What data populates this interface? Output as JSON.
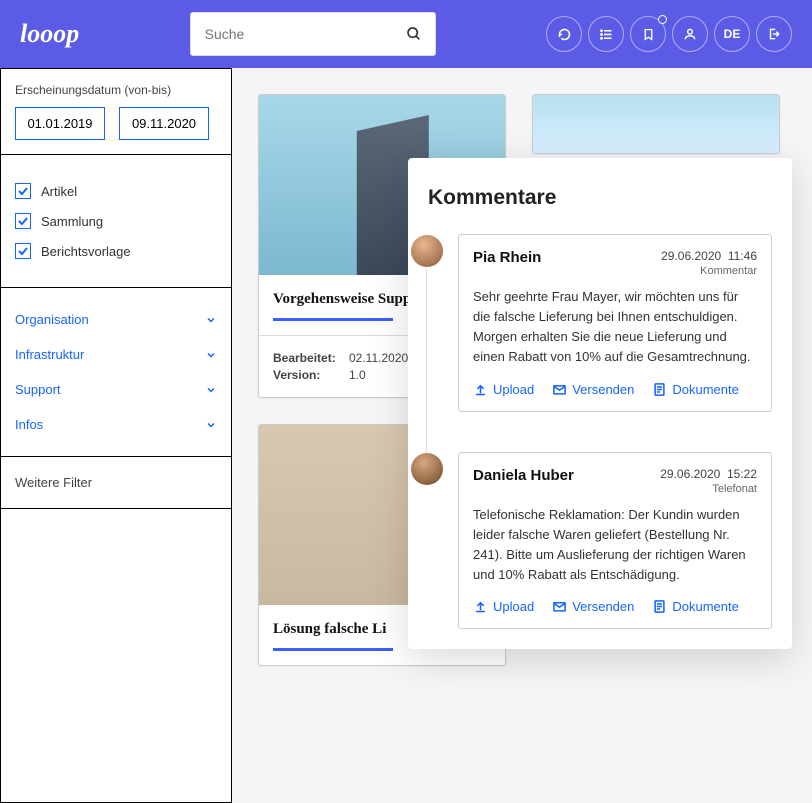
{
  "header": {
    "logo": "looop",
    "search_placeholder": "Suche",
    "lang": "DE"
  },
  "sidebar": {
    "date_label": "Erscheinungsdatum (von-bis)",
    "date_from": "01.01.2019",
    "date_to": "09.11.2020",
    "checks": [
      {
        "label": "Artikel"
      },
      {
        "label": "Sammlung"
      },
      {
        "label": "Berichtsvorlage"
      }
    ],
    "filters": [
      {
        "label": "Organisation"
      },
      {
        "label": "Infrastruktur"
      },
      {
        "label": "Support"
      },
      {
        "label": "Infos"
      }
    ],
    "more_filters": "Weitere Filter"
  },
  "cards": [
    {
      "title": "Vorgehensweise Support Anfrage",
      "edit_label": "Bearbeitet:",
      "edit_value": "02.11.2020",
      "version_label": "Version:",
      "version_value": "1.0"
    },
    {
      "title": "Lösung falsche Li"
    }
  ],
  "comments": {
    "title": "Kommentare",
    "items": [
      {
        "name": "Pia Rhein",
        "date": "29.06.2020",
        "time": "11:46",
        "type": "Kommentar",
        "body": "Sehr geehrte Frau Mayer, wir möchten uns für die falsche Lieferung bei Ihnen entschuldigen. Morgen erhalten Sie die neue Lieferung und einen Rabatt von 10% auf die Gesamtrechnung."
      },
      {
        "name": "Daniela Huber",
        "date": "29.06.2020",
        "time": "15:22",
        "type": "Telefonat",
        "body": "Telefonische Reklamation: Der Kundin wurden leider falsche Waren geliefert (Bestellung Nr. 241). Bitte um Auslieferung der richtigen Waren und 10% Rabatt als Entschädigung."
      }
    ],
    "actions": {
      "upload": "Upload",
      "send": "Versenden",
      "docs": "Dokumente"
    }
  }
}
